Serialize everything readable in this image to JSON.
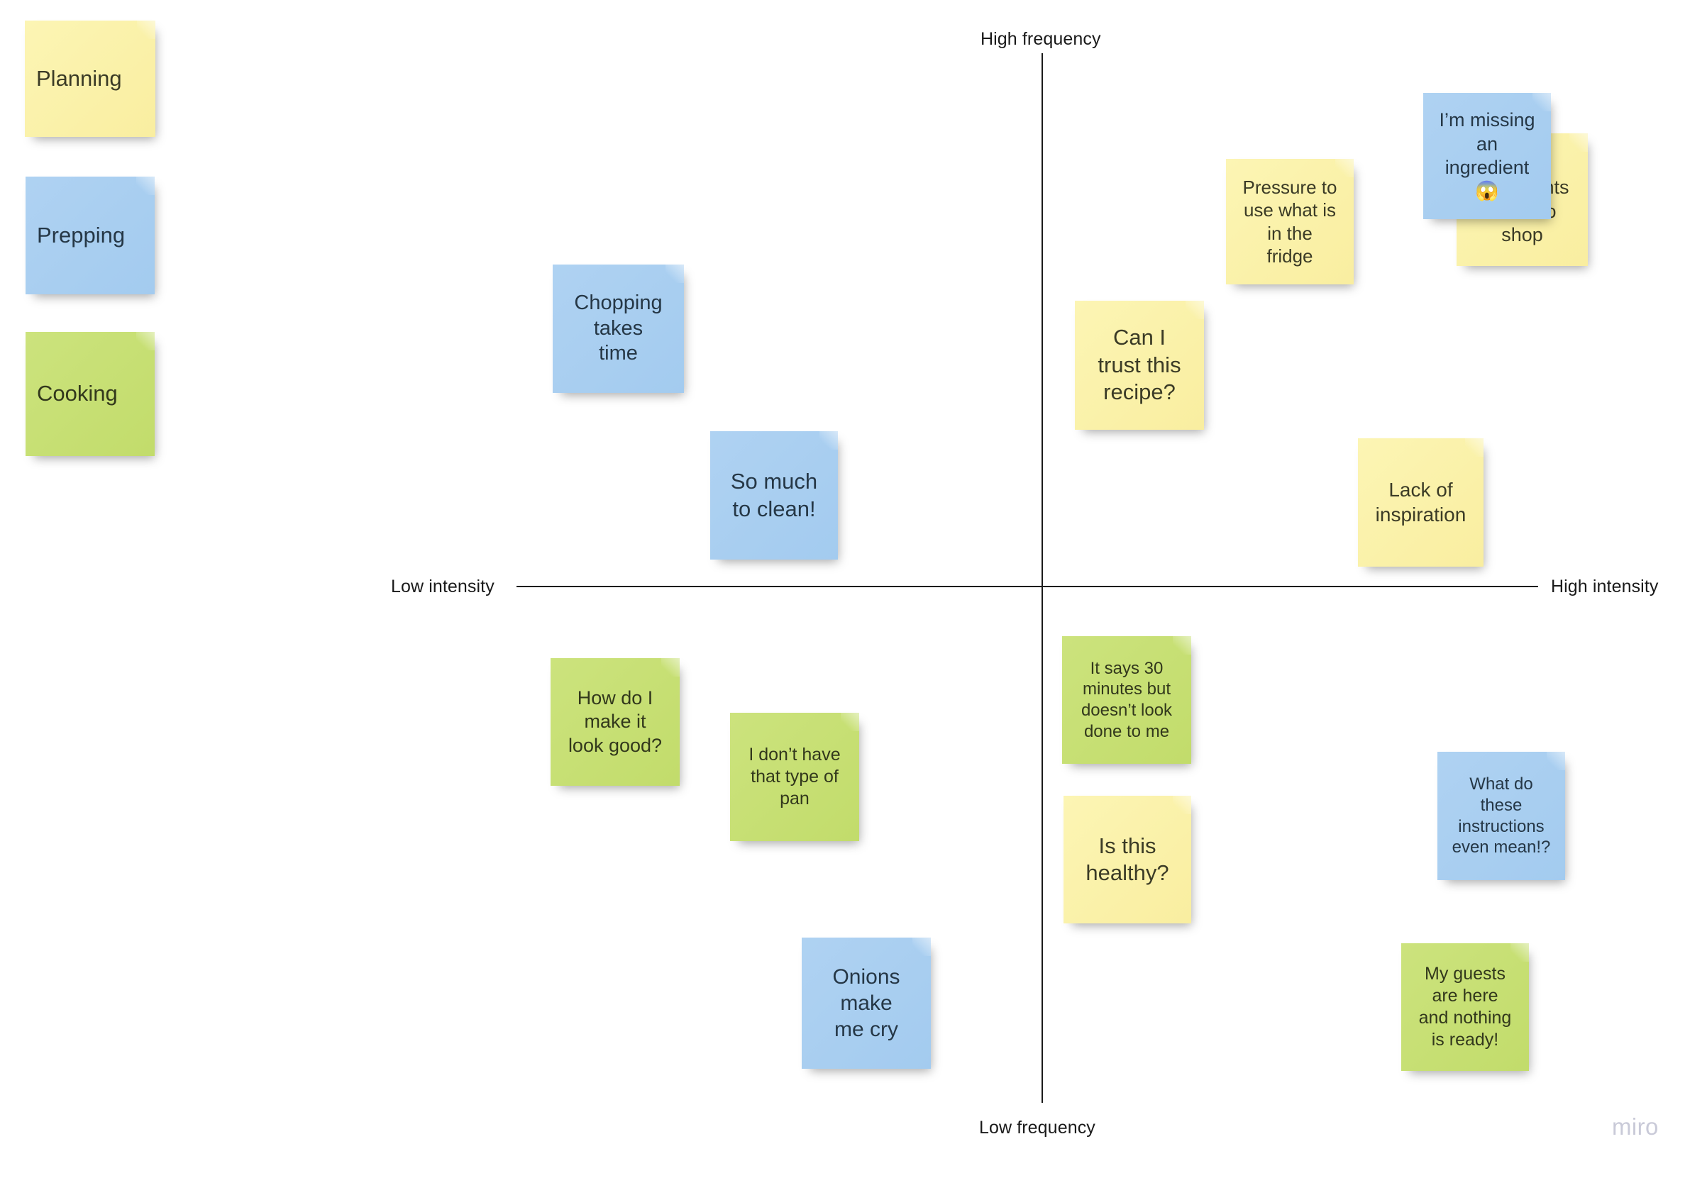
{
  "board": {
    "background_color": "#ffffff",
    "watermark": "miro"
  },
  "axes": {
    "top_label": "High frequency",
    "bottom_label": "Low frequency",
    "left_label": "Low intensity",
    "right_label": "High intensity",
    "line_color": "#1a1a1a"
  },
  "colors": {
    "yellow": "#fbf2a9",
    "blue": "#a9cff0",
    "green": "#c7df72",
    "text_dark": "#2b2b2b",
    "watermark": "#c9cad8"
  },
  "legend": {
    "items": [
      {
        "label": "Planning",
        "color": "yellow"
      },
      {
        "label": "Prepping",
        "color": "blue"
      },
      {
        "label": "Cooking",
        "color": "green"
      }
    ]
  },
  "notes": [
    {
      "text": "Chopping\ntakes\ntime",
      "color": "blue",
      "quadrant": "upper-left"
    },
    {
      "text": "So much\nto clean!",
      "color": "blue",
      "quadrant": "upper-left"
    },
    {
      "text": "Pressure to\nuse what is\nin the\nfridge",
      "color": "yellow",
      "quadrant": "upper-right"
    },
    {
      "text": "Buying\ningredients\n/ time to\nshop",
      "color": "yellow",
      "quadrant": "upper-right",
      "occluded": true
    },
    {
      "text": "I’m missing\nan\ningredient\n😱",
      "color": "blue",
      "quadrant": "upper-right"
    },
    {
      "text": "Can I\ntrust this\nrecipe?",
      "color": "yellow",
      "quadrant": "upper-right"
    },
    {
      "text": "Lack of\ninspiration",
      "color": "yellow",
      "quadrant": "upper-right"
    },
    {
      "text": "How do I\nmake it\nlook good?",
      "color": "green",
      "quadrant": "lower-left"
    },
    {
      "text": "I don’t have\nthat type of\npan",
      "color": "green",
      "quadrant": "lower-left"
    },
    {
      "text": "Onions\nmake\nme cry",
      "color": "blue",
      "quadrant": "lower-left"
    },
    {
      "text": "It says 30\nminutes but\ndoesn’t look\ndone to me",
      "color": "green",
      "quadrant": "lower-right"
    },
    {
      "text": "Is this\nhealthy?",
      "color": "yellow",
      "quadrant": "lower-right"
    },
    {
      "text": "What do\nthese\ninstructions\neven mean!?",
      "color": "blue",
      "quadrant": "lower-right"
    },
    {
      "text": "My guests\nare here\nand nothing\nis ready!",
      "color": "green",
      "quadrant": "lower-right"
    }
  ],
  "chart_data": {
    "type": "scatter",
    "title": "",
    "xlabel": "intensity",
    "ylabel": "frequency",
    "x_axis_left_label": "Low intensity",
    "x_axis_right_label": "High intensity",
    "y_axis_top_label": "High frequency",
    "y_axis_bottom_label": "Low frequency",
    "grid": false,
    "legend_position": "top-left",
    "legend": [
      "Planning",
      "Prepping",
      "Cooking"
    ],
    "points": [
      {
        "label": "Chopping takes time",
        "category": "Prepping",
        "intensity": -0.52,
        "frequency": 0.48
      },
      {
        "label": "So much to clean!",
        "category": "Prepping",
        "intensity": -0.37,
        "frequency": 0.18
      },
      {
        "label": "Pressure to use what is in the fridge",
        "category": "Planning",
        "intensity": 0.31,
        "frequency": 0.78
      },
      {
        "label": "Buying ingredients / time to shop",
        "category": "Planning",
        "intensity": 0.63,
        "frequency": 0.78
      },
      {
        "label": "I’m missing an ingredient 😱",
        "category": "Prepping",
        "intensity": 0.55,
        "frequency": 0.86
      },
      {
        "label": "Can I trust this recipe?",
        "category": "Planning",
        "intensity": 0.1,
        "frequency": 0.55
      },
      {
        "label": "Lack of inspiration",
        "category": "Planning",
        "intensity": 0.46,
        "frequency": 0.16
      },
      {
        "label": "How do I make it look good?",
        "category": "Cooking",
        "intensity": -0.52,
        "frequency": -0.21
      },
      {
        "label": "I don’t have that type of pan",
        "category": "Cooking",
        "intensity": -0.37,
        "frequency": -0.32
      },
      {
        "label": "Onions make me cry",
        "category": "Prepping",
        "intensity": -0.22,
        "frequency": -0.75
      },
      {
        "label": "It says 30 minutes but doesn’t look done to me",
        "category": "Cooking",
        "intensity": 0.08,
        "frequency": -0.17
      },
      {
        "label": "Is this healthy?",
        "category": "Planning",
        "intensity": 0.08,
        "frequency": -0.41
      },
      {
        "label": "What do these instructions even mean!?",
        "category": "Prepping",
        "intensity": 0.53,
        "frequency": -0.36
      },
      {
        "label": "My guests are here and nothing is ready!",
        "category": "Cooking",
        "intensity": 0.5,
        "frequency": -0.7
      }
    ]
  }
}
